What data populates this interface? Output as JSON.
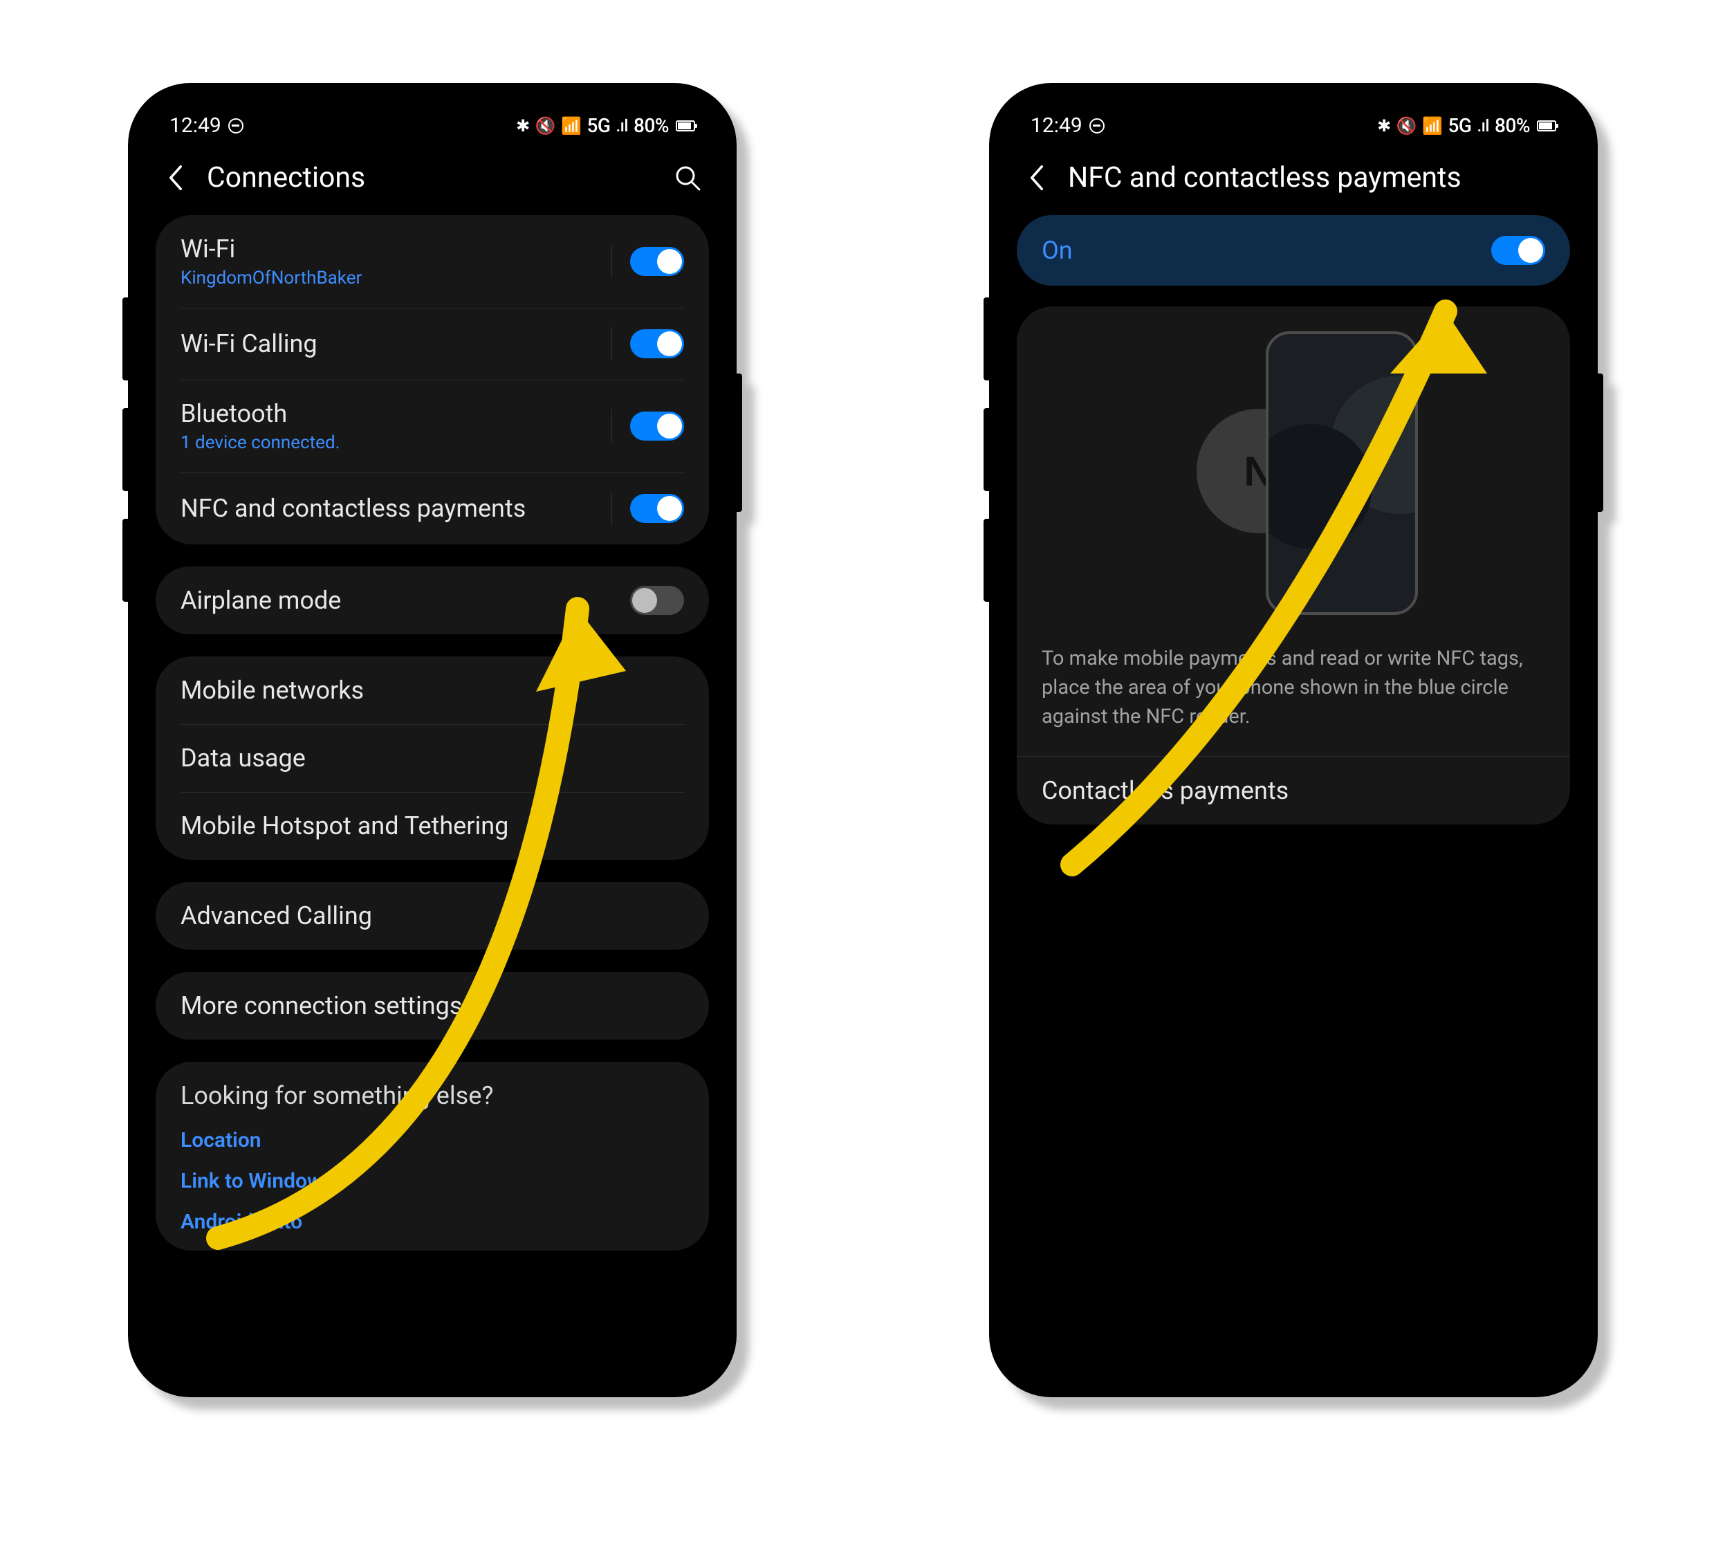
{
  "status": {
    "time": "12:49",
    "indicators": "✱ 🔇 📶 5G 📶 80%"
  },
  "left": {
    "title": "Connections",
    "group1": [
      {
        "title": "Wi-Fi",
        "sub": "KingdomOfNorthBaker",
        "toggle": "on",
        "div": true
      },
      {
        "title": "Wi-Fi Calling",
        "sub": "",
        "toggle": "on",
        "div": true
      },
      {
        "title": "Bluetooth",
        "sub": "1 device connected.",
        "toggle": "on",
        "div": true
      },
      {
        "title": "NFC and contactless payments",
        "sub": "",
        "toggle": "on",
        "div": true
      }
    ],
    "group2": [
      {
        "title": "Airplane mode",
        "sub": "",
        "toggle": "off",
        "div": false
      }
    ],
    "group3": [
      {
        "title": "Mobile networks"
      },
      {
        "title": "Data usage"
      },
      {
        "title": "Mobile Hotspot and Tethering"
      }
    ],
    "group4": [
      {
        "title": "Advanced Calling"
      }
    ],
    "group5": [
      {
        "title": "More connection settings"
      }
    ],
    "footer": {
      "title": "Looking for something else?",
      "links": [
        "Location",
        "Link to Windows",
        "Android Auto"
      ]
    }
  },
  "right": {
    "title": "NFC and contactless payments",
    "switch_label": "On",
    "nfc_glyph": "N",
    "desc": "To make mobile payments and read or write NFC tags, place the area of your phone shown in the blue circle against the NFC reader.",
    "row": "Contactless payments"
  }
}
